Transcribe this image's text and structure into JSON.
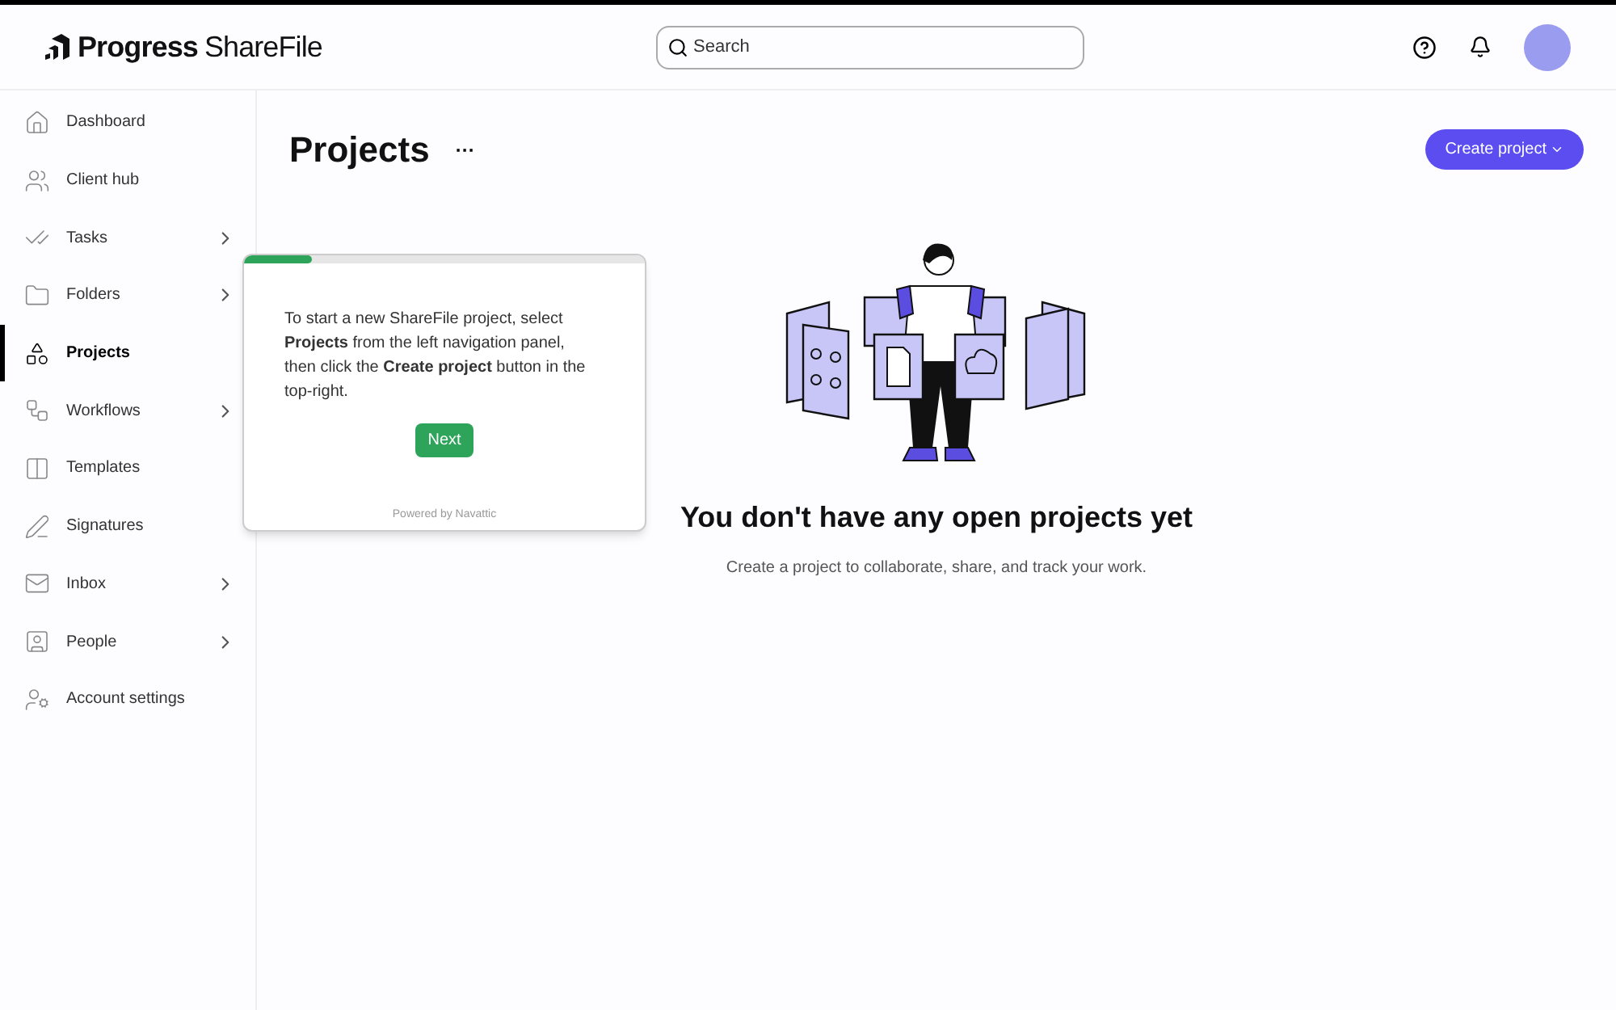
{
  "header": {
    "logo": {
      "brand": "Progress",
      "product": "ShareFile"
    },
    "search": {
      "placeholder": "Search"
    }
  },
  "sidebar": {
    "items": [
      {
        "kind": "home",
        "label": "Dashboard",
        "selected": false,
        "expandable": false
      },
      {
        "kind": "users",
        "label": "Client hub",
        "selected": false,
        "expandable": false
      },
      {
        "kind": "tasks",
        "label": "Tasks",
        "selected": false,
        "expandable": true
      },
      {
        "kind": "folder",
        "label": "Folders",
        "selected": false,
        "expandable": true
      },
      {
        "kind": "projects",
        "label": "Projects",
        "selected": true,
        "expandable": false
      },
      {
        "kind": "workflows",
        "label": "Workflows",
        "selected": false,
        "expandable": true
      },
      {
        "kind": "templates",
        "label": "Templates",
        "selected": false,
        "expandable": false
      },
      {
        "kind": "signatures",
        "label": "Signatures",
        "selected": false,
        "expandable": false
      },
      {
        "kind": "inbox",
        "label": "Inbox",
        "selected": false,
        "expandable": true
      },
      {
        "kind": "people",
        "label": "People",
        "selected": false,
        "expandable": true
      },
      {
        "kind": "account",
        "label": "Account settings",
        "selected": false,
        "expandable": false
      }
    ]
  },
  "page": {
    "title": "Projects",
    "more": "···",
    "create_button": "Create project"
  },
  "empty_state": {
    "title": "You don't have any open projects yet",
    "subtitle": "Create a project to collaborate, share, and track your work."
  },
  "tour": {
    "level": 0.17,
    "text": "To start a new ShareFile project, select **Projects** from the left navigation panel, then click the **Create project** button in the top-right.",
    "button": "Next",
    "footer": "Powered by Navattic"
  }
}
